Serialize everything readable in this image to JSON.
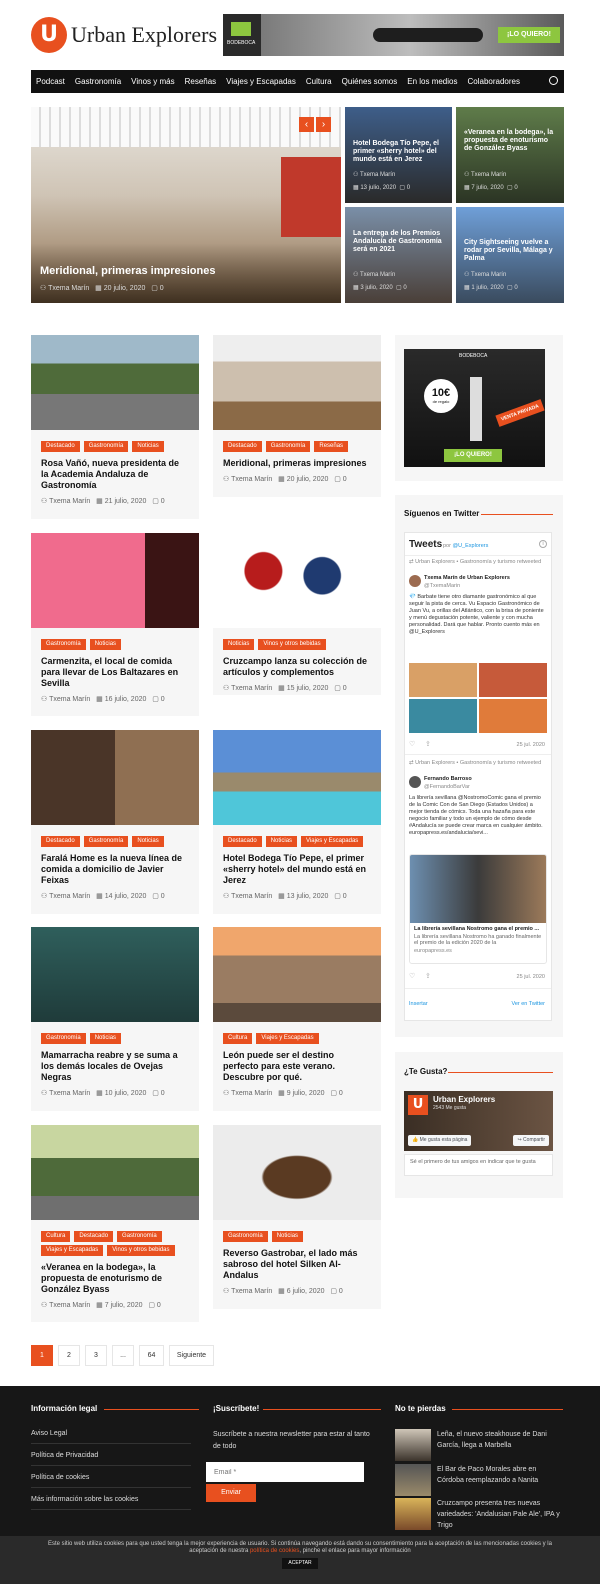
{
  "header": {
    "logo_letter": "U",
    "logo_text": "Urban Explorers",
    "banner_brand": "BODEBOCA",
    "banner_cta": "¡LO QUIERO!"
  },
  "nav": [
    "Podcast",
    "Gastronomía",
    "Vinos y más",
    "Reseñas",
    "Viajes y Escapadas",
    "Cultura",
    "Quiénes somos",
    "En los medios",
    "Colaboradores"
  ],
  "hero": {
    "main": {
      "title": "Meridional, primeras impresiones",
      "author": "Txema Marín",
      "date": "20 julio, 2020",
      "comments": "0"
    },
    "items": [
      {
        "title": "Hotel Bodega Tío Pepe, el primer «sherry hotel» del mundo está en Jerez",
        "author": "Txema Marín",
        "date": "13 julio, 2020",
        "comments": "0"
      },
      {
        "title": "«Veranea en la bodega», la propuesta de enoturismo de González Byass",
        "author": "Txema Marín",
        "date": "7 julio, 2020",
        "comments": "0"
      },
      {
        "title": "La entrega de los Premios Andalucía de Gastronomía será en 2021",
        "author": "Txema Marín",
        "date": "3 julio, 2020",
        "comments": "0"
      },
      {
        "title": "City Sightseeing vuelve a rodar por Sevilla, Málaga y Palma",
        "author": "Txema Marín",
        "date": "1 julio, 2020",
        "comments": "0"
      }
    ]
  },
  "posts": [
    {
      "tags": [
        "Destacado",
        "Gastronomía",
        "Noticias"
      ],
      "title": "Rosa Vañó, nueva presidenta de la Academia Andaluza de Gastronomía",
      "author": "Txema Marín",
      "date": "21 julio, 2020",
      "comments": "0"
    },
    {
      "tags": [
        "Destacado",
        "Gastronomía",
        "Reseñas"
      ],
      "title": "Meridional, primeras impresiones",
      "author": "Txema Marín",
      "date": "20 julio, 2020",
      "comments": "0"
    },
    {
      "tags": [
        "Gastronomía",
        "Noticias"
      ],
      "title": "Carmenzita, el local de comida para llevar de Los Baltazares en Sevilla",
      "author": "Txema Marín",
      "date": "16 julio, 2020",
      "comments": "0"
    },
    {
      "tags": [
        "Noticias",
        "Vinos y otros bebidas"
      ],
      "title": "Cruzcampo lanza su colección de artículos y complementos",
      "author": "Txema Marín",
      "date": "15 julio, 2020",
      "comments": "0"
    },
    {
      "tags": [
        "Destacado",
        "Gastronomía",
        "Noticias"
      ],
      "title": "Faralá Home es la nueva línea de comida a domicilio de Javier Feixas",
      "author": "Txema Marín",
      "date": "14 julio, 2020",
      "comments": "0"
    },
    {
      "tags": [
        "Destacado",
        "Noticias",
        "Viajes y Escapadas"
      ],
      "title": "Hotel Bodega Tío Pepe, el primer «sherry hotel» del mundo está en Jerez",
      "author": "Txema Marín",
      "date": "13 julio, 2020",
      "comments": "0"
    },
    {
      "tags": [
        "Gastronomía",
        "Noticias"
      ],
      "title": "Mamarracha reabre y se suma a los demás locales de Ovejas Negras",
      "author": "Txema Marín",
      "date": "10 julio, 2020",
      "comments": "0"
    },
    {
      "tags": [
        "Cultura",
        "Viajes y Escapadas"
      ],
      "title": "León puede ser el destino perfecto para este verano. Descubre por qué.",
      "author": "Txema Marín",
      "date": "9 julio, 2020",
      "comments": "0"
    },
    {
      "tags": [
        "Cultura",
        "Destacado",
        "Gastronomía",
        "Viajes y Escapadas",
        "Vinos y otros bebidas"
      ],
      "title": "«Veranea en la bodega», la propuesta de enoturismo de González Byass",
      "author": "Txema Marín",
      "date": "7 julio, 2020",
      "comments": "0"
    },
    {
      "tags": [
        "Gastronomía",
        "Noticias"
      ],
      "title": "Reverso Gastrobar, el lado más sabroso del hotel Silken Al-Andalus",
      "author": "Txema Marín",
      "date": "6 julio, 2020",
      "comments": "0"
    }
  ],
  "sidebar": {
    "ad": {
      "brand": "BODEBOCA",
      "price": "10€",
      "price_sub": "de regalo",
      "ribbon": "VENTA PRIVADA",
      "cta": "¡LO QUIERO!"
    },
    "twitter": {
      "title": "Síguenos en Twitter",
      "header": "Tweets",
      "by": "por",
      "handle": "@U_Explorers",
      "tweets": [
        {
          "retweet": "Urban Explorers • Gastronomía y turismo retweeted",
          "name": "Txema Marín de Urban Explorers",
          "user": "@TxemaMarin",
          "text": "💎 Barbate tiene otro diamante gastronómico al que seguir la pista de cerca. Vu Espacio Gastronómico de Juan Vu, a orillas del Atlántico, con la brisa de poniente y menú degustación potente, valiente y con mucha personalidad. Dará que hablar. Pronto cuento más en @U_Explorers",
          "date": "25 jul. 2020"
        },
        {
          "retweet": "Urban Explorers • Gastronomía y turismo retweeted",
          "name": "Fernando Barroso",
          "user": "@FernandoBarVar",
          "text": "La librería sevillana @NostromoComic gana el premio de la Comic Con de San Diego (Estados Unidos) a mejor tienda de cómics. Toda una hazaña para este negocio familiar y todo un ejemplo de cómo desde #Andalucía se puede crear marca en cualquier ámbito. europapress.es/andalucia/sevi...",
          "link_title": "La librería sevillana Nostromo gana el premio ...",
          "link_text": "La librería sevillana Nostromo ha ganado finalmente el premio de la edición 2020 de la",
          "link_domain": "europapress.es",
          "date": "25 jul. 2020"
        }
      ],
      "embed": "Insertar",
      "view": "Ver en Twitter"
    },
    "fb": {
      "title": "¿Te Gusta?",
      "page": "Urban Explorers",
      "likes": "2543 Me gusta",
      "like_btn": "Me gusta esta página",
      "share_btn": "Compartir",
      "friends": "Sé el primero de tus amigos en indicar que te gusta"
    }
  },
  "pagination": {
    "pages": [
      "1",
      "2",
      "3",
      "...",
      "64"
    ],
    "next": "Siguiente"
  },
  "footer": {
    "legal_title": "Información legal",
    "legal_links": [
      "Aviso Legal",
      "Política de Privacidad",
      "Política de cookies",
      "Más información sobre las cookies"
    ],
    "subscribe_title": "¡Suscríbete!",
    "subscribe_text": "Suscríbete a nuestra newsletter para estar al tanto de todo",
    "email_placeholder": "Email *",
    "send": "Enviar",
    "miss_title": "No te pierdas",
    "miss_items": [
      "Leña, el nuevo steakhouse de Dani García, llega a Marbella",
      "El Bar de Paco Morales abre en Córdoba reemplazando a Nanita",
      "Cruzcampo presenta tres nuevas variedades: 'Andalusian Pale Ale', IPA y Trigo"
    ]
  },
  "cookie": {
    "text1": "Este sitio web utiliza cookies para que usted tenga la mejor experiencia de usuario. Si continúa navegando está dando su consentimiento para la aceptación de las mencionadas cookies y la",
    "text2": "aceptación de nuestra",
    "link": "política de cookies",
    "text3": ", pinche el enlace para mayor información",
    "accept": "ACEPTAR"
  },
  "colors": {
    "accent": "#e8501f",
    "dark": "#111111"
  }
}
